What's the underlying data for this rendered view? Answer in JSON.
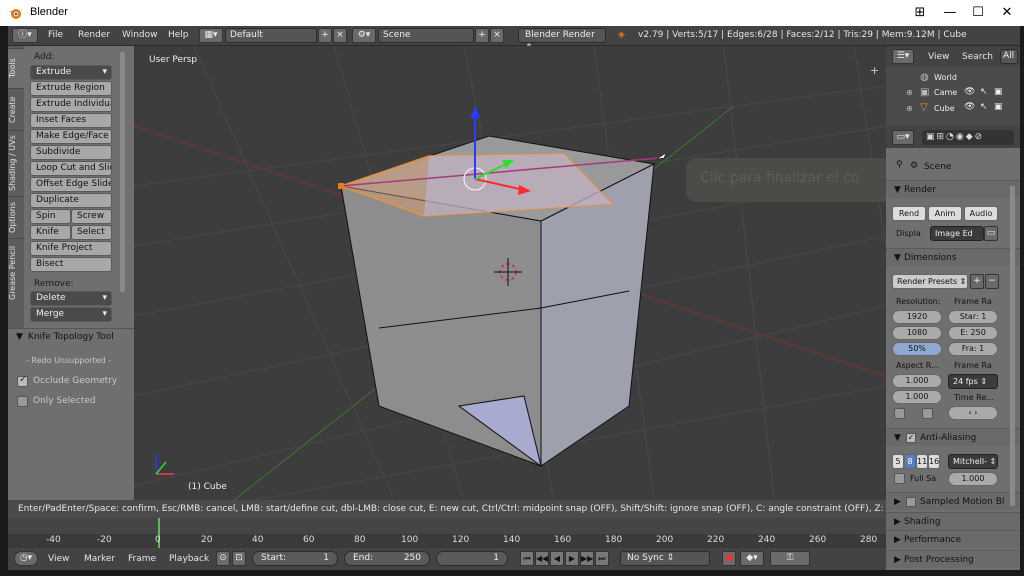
{
  "window": {
    "title": "Blender"
  },
  "infobar": {
    "menus": [
      "File",
      "Render",
      "Window",
      "Help"
    ],
    "screen_layout": "Default",
    "scene": "Scene",
    "engine": "Blender Render",
    "stats": "v2.79 | Verts:5/17 | Edges:6/28 | Faces:2/12 | Tris:29 | Mem:9.12M | Cube"
  },
  "toolshelf": {
    "tabs": [
      "Tools",
      "Create",
      "Shading / UVs",
      "Options",
      "Grease Pencil"
    ],
    "add_label": "Add:",
    "extrude": "Extrude",
    "buttons": [
      "Extrude Region",
      "Extrude Individual",
      "Inset Faces",
      "Make Edge/Face",
      "Subdivide",
      "Loop Cut and Slide",
      "Offset Edge Slide",
      "Duplicate"
    ],
    "spin": "Spin",
    "screw": "Screw",
    "knife": "Knife",
    "select": "Select",
    "knife_project": "Knife Project",
    "bisect": "Bisect",
    "remove_label": "Remove:",
    "delete": "Delete",
    "merge": "Merge"
  },
  "operator": {
    "title": "Knife Topology Tool",
    "redo": "- Redo Unsupported -",
    "occlude": "Occlude Geometry",
    "only_selected": "Only Selected"
  },
  "viewport": {
    "view_name": "User Persp",
    "object_label": "(1) Cube",
    "overlay_text": "Clic para finalizar el co"
  },
  "status": "Enter/PadEnter/Space: confirm, Esc/RMB: cancel, LMB: start/define cut, dbl-LMB: close cut, E: new cut, Ctrl/Ctrl: midpoint snap (OFF), Shift/Shift: ignore snap (OFF), C: angle constraint (OFF), Z: cut through (ON), MMB: ",
  "timeline": {
    "ticks": [
      "-40",
      "-20",
      "0",
      "20",
      "40",
      "60",
      "80",
      "100",
      "120",
      "140",
      "160",
      "180",
      "200",
      "220",
      "240",
      "260",
      "280"
    ],
    "menus": [
      "View",
      "Marker",
      "Frame",
      "Playback"
    ],
    "start_label": "Start:",
    "start_value": "1",
    "end_label": "End:",
    "end_value": "250",
    "current_frame": "1",
    "sync": "No Sync"
  },
  "outliner": {
    "view": "View",
    "search": "Search",
    "all": "All",
    "items": [
      "World",
      "Came",
      "Cube"
    ]
  },
  "properties": {
    "scene": "Scene",
    "render_panel": "Render",
    "render_btn": "Rend",
    "anim_btn": "Anim",
    "audio_btn": "Audio",
    "display_label": "Displa",
    "display_value": "Image Ed",
    "dimensions_panel": "Dimensions",
    "render_presets": "Render Presets",
    "resolution_label": "Resolution:",
    "frame_range_label": "Frame Ra",
    "res_x": "1920",
    "res_y": "1080",
    "res_pct": "50%",
    "start_frame": "Star: 1",
    "end_frame": "E: 250",
    "frame_step": "Fra: 1",
    "aspect_label": "Aspect R...",
    "frame_rate_label": "Frame Ra",
    "aspect_x": "1.000",
    "aspect_y": "1.000",
    "fps": "24 fps",
    "time_remap": "Time Re...",
    "aa_panel": "Anti-Aliasing",
    "aa_samples": [
      "5",
      "8",
      "11",
      "16"
    ],
    "aa_filter": "Mitchell-",
    "full_sample": "Full Sa",
    "filter_size": "1.000",
    "sampled_motion": "Sampled Motion Bl",
    "shading": "Shading",
    "performance": "Performance",
    "post_processing": "Post Processing"
  }
}
